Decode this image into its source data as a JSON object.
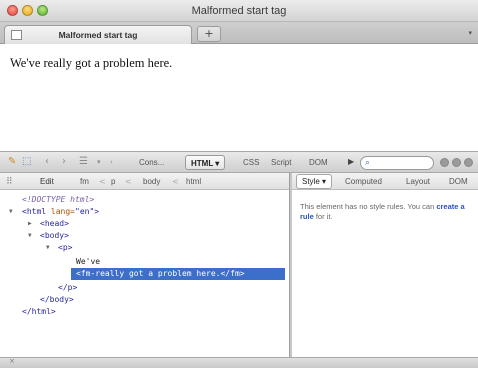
{
  "window": {
    "title": "Malformed start tag"
  },
  "tabs": [
    {
      "label": "Malformed start tag"
    }
  ],
  "new_tab_label": "+",
  "tab_menu_label": "▾",
  "page": {
    "text": "We've really got a problem here."
  },
  "devtools": {
    "toolbar": {
      "icons": [
        "pointer-icon",
        "inspect-icon",
        "back-icon",
        "forward-icon",
        "list-icon",
        "menu-icon"
      ],
      "menu_arrow": "▾",
      "panels": [
        "Cons...",
        "HTML ▾",
        "CSS",
        "Script",
        "DOM"
      ],
      "active_panel": "HTML ▾",
      "more_arrow": "▶",
      "search_placeholder": ""
    },
    "breadcrumb": {
      "edit_label": "Edit",
      "items": [
        "fm",
        "p",
        "body",
        "html"
      ],
      "separator": "<"
    },
    "tree": {
      "doctype": "<!DOCTYPE html>",
      "html_open": "<html ",
      "lang_attr": "lang=",
      "lang_val": "\"en\"",
      "close_gt": ">",
      "head": "<head>",
      "body_open": "<body>",
      "p_open": "<p>",
      "text_node": "We've",
      "selected_node": "<fm-really got a problem here.</fm>",
      "p_close": "</p>",
      "body_close": "</body>",
      "html_close": "</html>"
    },
    "side_panel": {
      "tabs": [
        "Style ▾",
        "Computed",
        "Layout",
        "DOM"
      ],
      "active_tab": "Style ▾",
      "message_before": "This element has no style rules. You can ",
      "message_link": "create a rule",
      "message_after": " for it."
    },
    "status_close": "×"
  },
  "colors": {
    "selection": "#3b6fc9",
    "tag": "#28289c",
    "link": "#2c55b8"
  }
}
